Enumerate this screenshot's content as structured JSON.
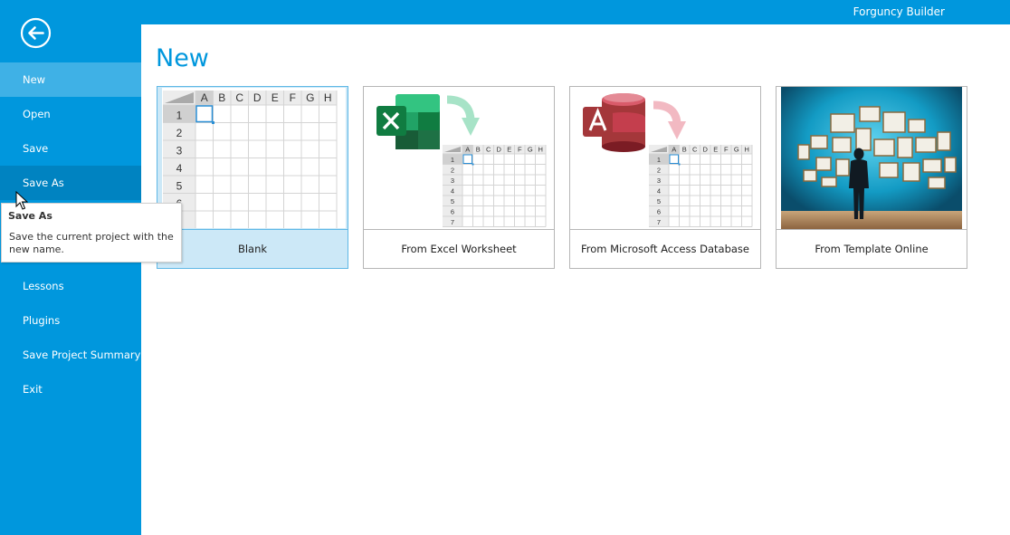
{
  "app": {
    "title": "Forguncy Builder"
  },
  "sidebar": {
    "back_icon": "back-arrow-icon",
    "items": [
      {
        "label": "New"
      },
      {
        "label": "Open"
      },
      {
        "label": "Save"
      },
      {
        "label": "Save As"
      },
      {
        "label": "Lessons"
      },
      {
        "label": "Plugins"
      },
      {
        "label": "Save Project Summary"
      },
      {
        "label": "Exit"
      }
    ]
  },
  "tooltip": {
    "title": "Save As",
    "description": "Save the current project with the new name."
  },
  "main": {
    "title": "New",
    "tiles": [
      {
        "label": "Blank",
        "icon": "blank-spreadsheet-icon"
      },
      {
        "label": "From Excel Worksheet",
        "icon": "excel-import-icon"
      },
      {
        "label": "From Microsoft Access Database",
        "icon": "access-import-icon"
      },
      {
        "label": "From Template Online",
        "icon": "template-gallery-icon"
      }
    ]
  },
  "grid": {
    "columns": [
      "A",
      "B",
      "C",
      "D",
      "E",
      "F",
      "G",
      "H"
    ],
    "rows": [
      "1",
      "2",
      "3",
      "4",
      "5",
      "6",
      "7"
    ]
  },
  "colors": {
    "accent": "#0097dd",
    "nav_selected": "#3fb1e6",
    "nav_hover": "#0083c1",
    "tile_selected": "#cce8f7",
    "excel_green": "#1e7145",
    "access_red": "#a4373a"
  }
}
